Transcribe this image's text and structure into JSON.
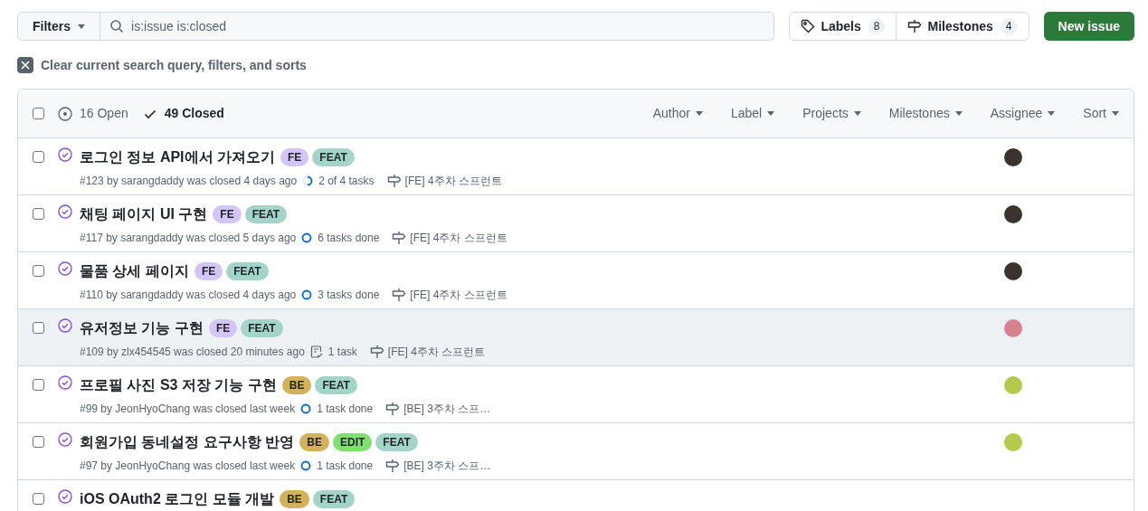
{
  "toolbar": {
    "filters_button": "Filters",
    "search": {
      "value": "is:issue is:closed"
    },
    "labels_button": {
      "label": "Labels",
      "count": "8"
    },
    "milestones_button": {
      "label": "Milestones",
      "count": "4"
    },
    "new_issue_button": "New issue"
  },
  "clear_filters": "Clear current search query, filters, and sorts",
  "list_header": {
    "checked": false,
    "states": [
      {
        "count_label": "16 Open",
        "selected": false
      },
      {
        "count_label": "49 Closed",
        "selected": true
      }
    ],
    "filters": [
      "Author",
      "Label",
      "Projects",
      "Milestones",
      "Assignee",
      "Sort"
    ]
  },
  "issues": [
    {
      "title": "로그인 정보 API에서 가져오기",
      "labels": [
        {
          "name": "FE",
          "color": "#d4c5f9"
        },
        {
          "name": "FEAT",
          "color": "#a2d5c8"
        }
      ],
      "meta": "#123 by sarangdaddy was closed 4 days ago",
      "tasks": {
        "kind": "ring",
        "done": false,
        "text": "2 of 4 tasks"
      },
      "milestone": "[FE] 4주차 스프런트",
      "assignee": {
        "color": "#3a3330"
      },
      "checked": false,
      "highlighted": false
    },
    {
      "title": "채팅 페이지 UI 구현",
      "labels": [
        {
          "name": "FE",
          "color": "#d4c5f9"
        },
        {
          "name": "FEAT",
          "color": "#a2d5c8"
        }
      ],
      "meta": "#117 by sarangdaddy was closed 5 days ago",
      "tasks": {
        "kind": "ring",
        "done": true,
        "text": "6 tasks done"
      },
      "milestone": "[FE] 4주차 스프런트",
      "assignee": {
        "color": "#3a3330"
      },
      "checked": false,
      "highlighted": false
    },
    {
      "title": "물품 상세 페이지",
      "labels": [
        {
          "name": "FE",
          "color": "#d4c5f9"
        },
        {
          "name": "FEAT",
          "color": "#a2d5c8"
        }
      ],
      "meta": "#110 by sarangdaddy was closed 4 days ago",
      "tasks": {
        "kind": "ring",
        "done": true,
        "text": "3 tasks done"
      },
      "milestone": "[FE] 4주차 스프런트",
      "assignee": {
        "color": "#3a3330"
      },
      "checked": false,
      "highlighted": false
    },
    {
      "title": "유저정보 기능 구현",
      "labels": [
        {
          "name": "FE",
          "color": "#d4c5f9"
        },
        {
          "name": "FEAT",
          "color": "#a2d5c8"
        }
      ],
      "meta": "#109 by zlx454545 was closed 20 minutes ago",
      "tasks": {
        "kind": "list",
        "text": "1 task"
      },
      "milestone": "[FE] 4주차 스프런트",
      "assignee": {
        "color": "#d9808f"
      },
      "checked": false,
      "highlighted": true
    },
    {
      "title": "프로필 사진 S3 저장 기능 구현",
      "labels": [
        {
          "name": "BE",
          "color": "#d4b25b"
        },
        {
          "name": "FEAT",
          "color": "#a2d5c8"
        }
      ],
      "meta": "#99 by JeonHyoChang was closed last week",
      "tasks": {
        "kind": "ring",
        "done": true,
        "text": "1 task done"
      },
      "milestone": "[BE] 3주차 스프…",
      "assignee": {
        "color": "#b5c94a"
      },
      "checked": false,
      "highlighted": false
    },
    {
      "title": "회원가입 동네설정 요구사항 반영",
      "labels": [
        {
          "name": "BE",
          "color": "#d4b25b"
        },
        {
          "name": "EDIT",
          "color": "#7ee06e"
        },
        {
          "name": "FEAT",
          "color": "#a2d5c8"
        }
      ],
      "meta": "#97 by JeonHyoChang was closed last week",
      "tasks": {
        "kind": "ring",
        "done": true,
        "text": "1 task done"
      },
      "milestone": "[BE] 3주차 스프…",
      "assignee": {
        "color": "#b5c94a"
      },
      "checked": false,
      "highlighted": false
    },
    {
      "title": "iOS OAuth2 로그인 모듈 개발",
      "labels": [
        {
          "name": "BE",
          "color": "#d4b25b"
        },
        {
          "name": "FEAT",
          "color": "#a2d5c8"
        }
      ],
      "checked": false,
      "highlighted": false
    }
  ]
}
